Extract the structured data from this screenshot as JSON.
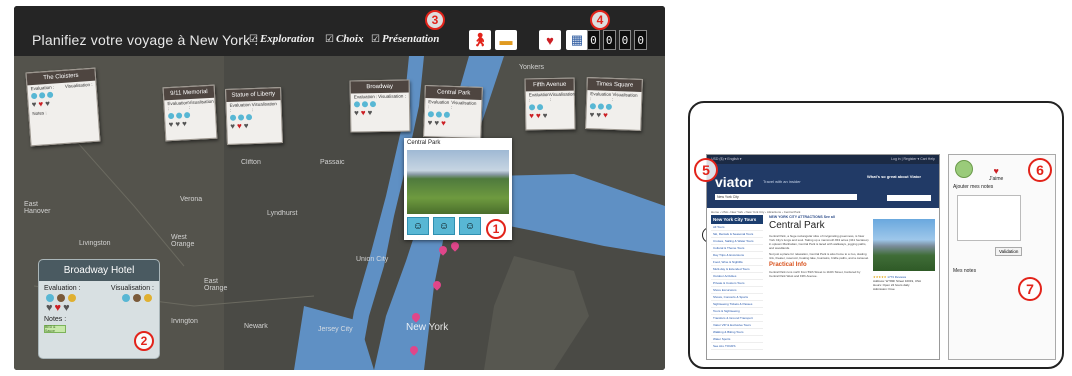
{
  "board": {
    "title": "Planifiez votre voyage à New York :",
    "steps": [
      "Exploration",
      "Choix",
      "Présentation"
    ],
    "check_glyph": "☑",
    "timer": [
      "0",
      "0",
      "0",
      "0"
    ],
    "icons": [
      "hiker-icon",
      "bed-icon",
      "heart-icon",
      "grid-icon"
    ]
  },
  "map_labels": {
    "yonkers": "Yonkers",
    "clifton": "Clifton",
    "passaic": "Passaic",
    "verona": "Verona",
    "east_hanover": "East Hanover",
    "livingston": "Livingston",
    "west_orange": "West Orange",
    "lyndhurst": "Lyndhurst",
    "east_orange": "East Orange",
    "union_city": "Union City",
    "irvington": "Irvington",
    "newark": "Newark",
    "jersey_city": "Jersey City",
    "new_york": "New York"
  },
  "cards": [
    {
      "name": "The Cloisters",
      "eval": "Evaluation :",
      "vis": "Visualisation :",
      "notes": "Notes :"
    },
    {
      "name": "9/11 Memorial",
      "eval": "Evaluation :",
      "vis": "Visualisation :"
    },
    {
      "name": "Statue of Liberty",
      "eval": "Evaluation :",
      "vis": "Visualisation :"
    },
    {
      "name": "Broadway",
      "eval": "Evaluation :",
      "vis": "Visualisation :"
    },
    {
      "name": "Central Park",
      "eval": "Evaluation :",
      "vis": "Visualisation :"
    },
    {
      "name": "Fifth Avenue",
      "eval": "Evaluation :",
      "vis": "Visualisation :"
    },
    {
      "name": "Times Square",
      "eval": "Evaluation :",
      "vis": "Visualisation :"
    }
  ],
  "hotel": {
    "title": "Broadway Hotel",
    "evaluation": "Evaluation :",
    "visualisation": "Visualisation :",
    "notes": "Notes :",
    "note_tag": "BED & Sauce"
  },
  "popup": {
    "title": "Central Park"
  },
  "badges": [
    "1",
    "2",
    "3",
    "4",
    "5",
    "6",
    "7"
  ],
  "colors": {
    "accent_red": "#e2231a",
    "heart_red": "#cc1f24",
    "viator_blue": "#213a66",
    "pin_pink": "#e0468a"
  },
  "tablet": {
    "site": {
      "nav_left": "USD ($) ▾   English ▾",
      "nav_right": "Log in | Register ▾   Cart   Help",
      "logo": "viator",
      "tagline": "Travel with an insider",
      "great": "What's so great about Viator",
      "search_value": "New York City",
      "breadcrumb": "Home › USA › New York › New York City › Attractions › Central Park",
      "side_header": "New York City Tours",
      "side_items": [
        "All Tours",
        "Ski, Rentals & Seasonal Tours",
        "Cruises, Sailing & Water Tours",
        "Cultural & Theme Tours",
        "Day Trips & Excursions",
        "Food, Wine & Nightlife",
        "Multi-day & Extended Tours",
        "Outdoor Activities",
        "Private & Custom Tours",
        "Shore Excursions",
        "Shows, Concerts & Sports",
        "Sightseeing Tickets & Passes",
        "Tours & Sightseeing",
        "Transfers & Ground Transport",
        "Viator VIP & Exclusive Tours",
        "Walking & Biking Tours",
        "Water Sports",
        "See ALL TOURS"
      ],
      "kicker": "NEW YORK CITY ATTRACTIONS See all",
      "heading": "Central Park",
      "para1": "Central Park, a huge rectangular slice of invigorating greenness, is New York City's lungs and soul. Taking up a mammoth 843 acres (341 hectares) in uptown Manhattan, Central Park is laced with walkways, jogging paths, and woodlands.",
      "para2": "Not just a place for relaxation, Central Park is also home to a zoo, skating rink, theater, reservoir, boating lake, fountains, bridle paths, and a carousel.",
      "practical": "Practical Info",
      "para3": "Central Park runs north from 59th Street to 110th Street, bordered by Central Park West and Fifth Avenue.",
      "reviews": "1773 Reviews",
      "address": "Address: W 59th Street 10019, USA",
      "hours": "Hours: Open 24 hours daily",
      "admission": "Admission: Free"
    },
    "notes": {
      "like": "J'aime",
      "add_title": "Ajouter mes notes",
      "validate": "Validation",
      "mine": "Mes notes"
    }
  }
}
